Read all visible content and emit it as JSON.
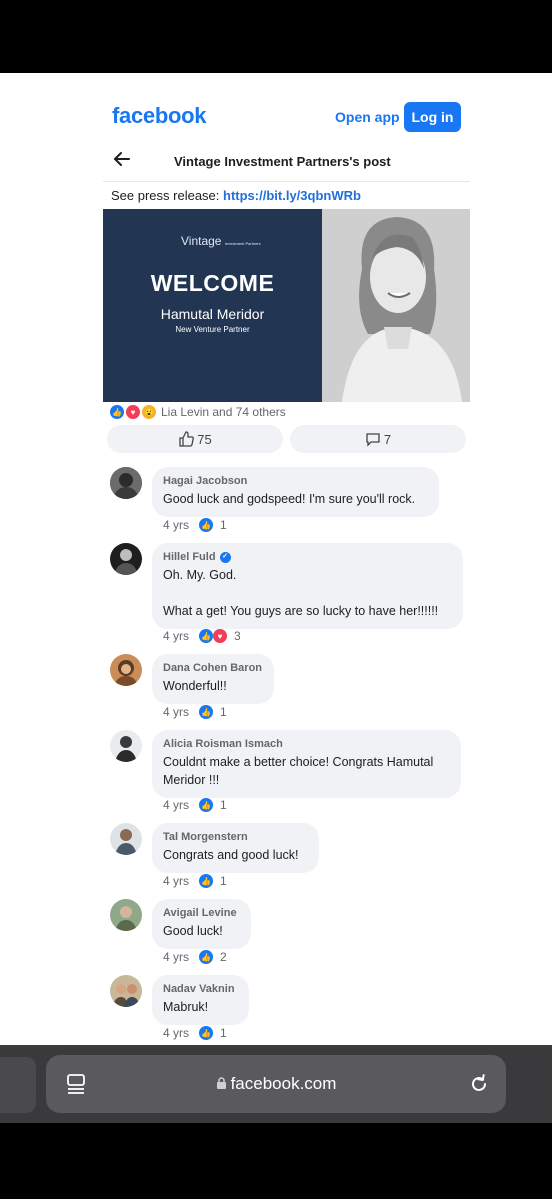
{
  "header": {
    "logo": "facebook",
    "open_app": "Open app",
    "login": "Log in"
  },
  "post": {
    "title": "Vintage Investment Partners's post",
    "press_prefix": "See press release: ",
    "press_link": "https://bit.ly/3qbnWRb"
  },
  "banner": {
    "brand": "Vintage",
    "brand_small": "Investment Partners",
    "welcome": "WELCOME",
    "name": "Hamutal Meridor",
    "role": "New Venture Partner"
  },
  "reactions": {
    "summary": "Lia Levin and 74 others",
    "like_count": "75",
    "comment_count": "7"
  },
  "comments": [
    {
      "name": "Hagai Jacobson",
      "text": "Good luck and godspeed! I'm sure you'll rock.",
      "time": "4 yrs",
      "reaction_count": "1",
      "verified": false
    },
    {
      "name": "Hillel Fuld",
      "text": "Oh. My. God.\n\nWhat a get! You guys are so lucky to have her!!!!!!",
      "time": "4 yrs",
      "reaction_count": "3",
      "verified": true
    },
    {
      "name": "Dana Cohen Baron",
      "text": "Wonderful!!",
      "time": "4 yrs",
      "reaction_count": "1",
      "verified": false
    },
    {
      "name": "Alicia Roisman Ismach",
      "text": "Couldnt make a better choice! Congrats Hamutal\nMeridor !!!",
      "time": "4 yrs",
      "reaction_count": "1",
      "verified": false
    },
    {
      "name": "Tal Morgenstern",
      "text": "Congrats and good luck!",
      "time": "4 yrs",
      "reaction_count": "1",
      "verified": false
    },
    {
      "name": "Avigail Levine",
      "text": "Good luck!",
      "time": "4 yrs",
      "reaction_count": "2",
      "verified": false
    },
    {
      "name": "Nadav Vaknin",
      "text": "Mabruk!",
      "time": "4 yrs",
      "reaction_count": "1",
      "verified": false
    }
  ],
  "browser": {
    "url": "facebook.com"
  },
  "colors": {
    "brand_blue": "#1877f2",
    "banner_navy": "#223654",
    "bubble_gray": "#f0f2f5"
  }
}
